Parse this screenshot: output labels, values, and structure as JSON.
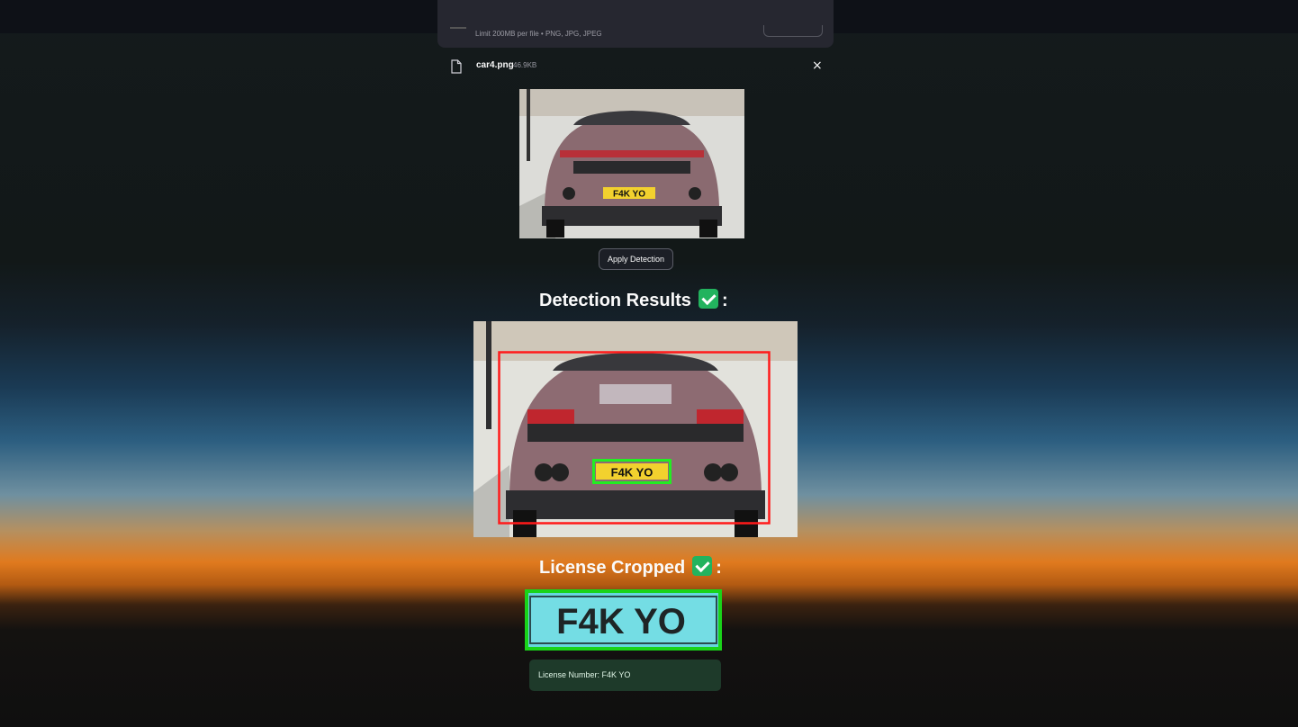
{
  "uploader": {
    "limit_text": "Limit 200MB per file • PNG, JPG, JPEG"
  },
  "file": {
    "name": "car4.png",
    "size": "46.9KB",
    "close": "×",
    "icon": "file-icon"
  },
  "actions": {
    "apply_label": "Apply Detection"
  },
  "detection": {
    "heading": "Detection Results",
    "suffix": ":",
    "icon": "check-mark-icon",
    "plate_text": "F4K YO",
    "colors": {
      "vehicle_box": "#ff1a1a",
      "plate_box": "#22ee22"
    }
  },
  "license": {
    "heading": "License Cropped",
    "suffix": ":",
    "icon": "check-mark-icon",
    "plate_text": "F4K YO",
    "result_text": "License Number: F4K YO"
  },
  "preview": {
    "plate_text": "F4K YO"
  }
}
